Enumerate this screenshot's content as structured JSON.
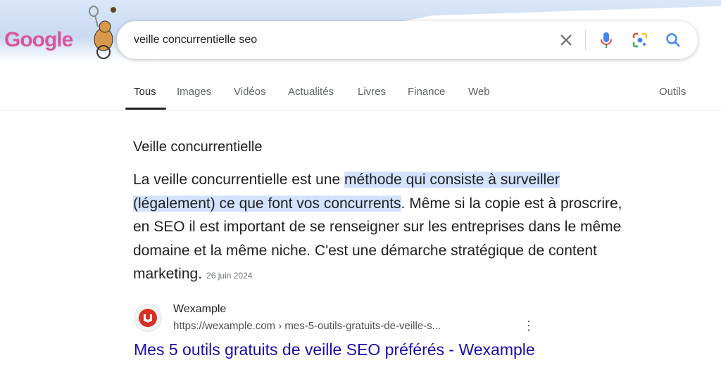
{
  "logo": {
    "text": "Google"
  },
  "search": {
    "query": "veille concurrentielle seo"
  },
  "tabs": [
    {
      "label": "Tous",
      "active": true
    },
    {
      "label": "Images"
    },
    {
      "label": "Vidéos"
    },
    {
      "label": "Actualités"
    },
    {
      "label": "Livres"
    },
    {
      "label": "Finance"
    },
    {
      "label": "Web"
    }
  ],
  "tools_label": "Outils",
  "snippet": {
    "title": "Veille concurrentielle",
    "text_before": "La veille concurrentielle est une ",
    "text_highlight": "méthode qui consiste à surveiller (légalement) ce que font vos concurrents",
    "text_after": ". Même si la copie est à proscrire, en SEO il est important de se renseigner sur les entreprises dans le même domaine et la même niche. C'est une démarche stratégique de content marketing.",
    "date": "26 juin 2024",
    "highlight_color": "#d3e3fd"
  },
  "result": {
    "site_name": "Wexample",
    "url": "https://wexample.com › mes-5-outils-gratuits-de-veille-s...",
    "title": "Mes 5 outils gratuits de veille SEO préférés - Wexample",
    "link_color": "#1a0dab",
    "favicon_color": "#d93025"
  }
}
